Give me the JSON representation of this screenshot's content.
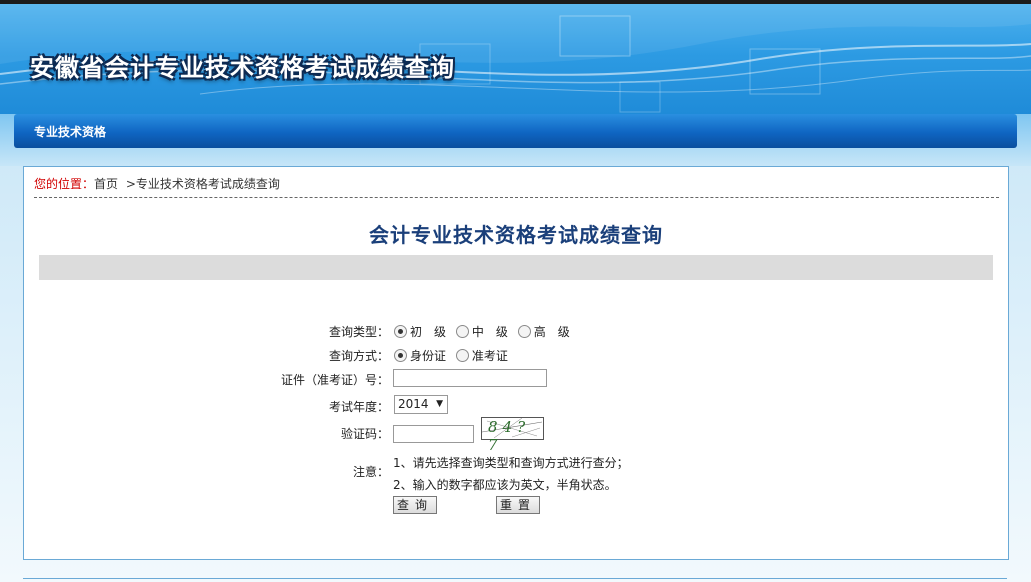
{
  "header": {
    "title": "安徽省会计专业技术资格考试成绩查询"
  },
  "nav": {
    "item": "专业技术资格"
  },
  "breadcrumb": {
    "label": "您的位置：",
    "home": "首页",
    "separator": ">",
    "current": "专业技术资格考试成绩查询"
  },
  "page": {
    "title": "会计专业技术资格考试成绩查询"
  },
  "form": {
    "query_type": {
      "label": "查询类型：",
      "options": [
        "初　级",
        "中　级",
        "高　级"
      ],
      "selected": 0
    },
    "query_method": {
      "label": "查询方式：",
      "options": [
        "身份证",
        "准考证"
      ],
      "selected": 0
    },
    "id_number": {
      "label": "证件（准考证）号：",
      "value": ""
    },
    "exam_year": {
      "label": "考试年度：",
      "value": "2014"
    },
    "captcha": {
      "label": "验证码：",
      "value": "",
      "image_text": "84?7"
    },
    "note": {
      "label": "注意：",
      "lines": [
        "1、请先选择查询类型和查询方式进行查分；",
        "2、输入的数字都应该为英文，半角状态。"
      ]
    },
    "submit_label": "查询",
    "reset_label": "重置"
  },
  "colors": {
    "banner": "#2d9be3",
    "nav": "#0f65c2",
    "title": "#1a3f7a",
    "breadcrumb_label": "#d10000"
  }
}
